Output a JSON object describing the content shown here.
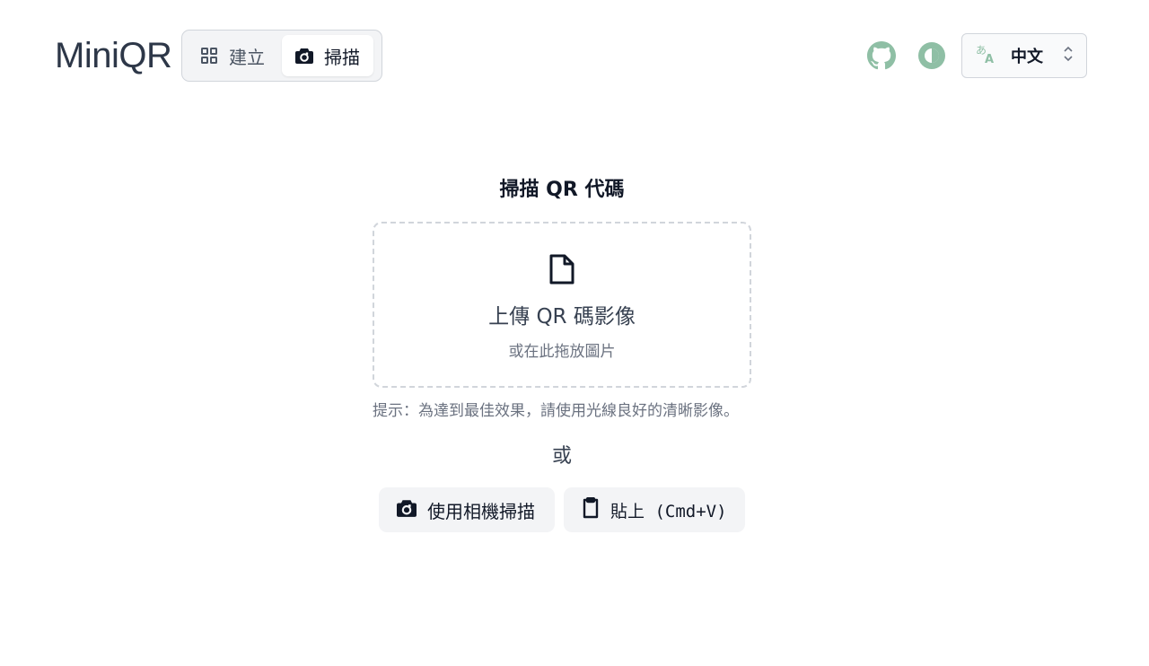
{
  "app": {
    "logo": "MiniQR"
  },
  "mode_tabs": [
    {
      "label": "建立",
      "icon": "grid-icon",
      "active": false
    },
    {
      "label": "掃描",
      "icon": "camera-icon",
      "active": true
    }
  ],
  "header_actions": {
    "github_icon": "github-icon",
    "theme_icon": "theme-contrast-icon",
    "language": {
      "icon": "translate-icon",
      "selected": "中文"
    }
  },
  "scan": {
    "title": "掃描 QR 代碼",
    "drop_zone": {
      "icon": "file-icon",
      "title": "上傳 QR 碼影像",
      "subtitle": "或在此拖放圖片"
    },
    "hint": "提示：為達到最佳效果，請使用光線良好的清晰影像。",
    "or": "或",
    "camera_button": "使用相機掃描",
    "paste_button": "貼上 (Cmd+V)"
  },
  "colors": {
    "icon_green": "#8fbfa5",
    "surface": "#f3f4f6",
    "border": "#d1d5db"
  }
}
